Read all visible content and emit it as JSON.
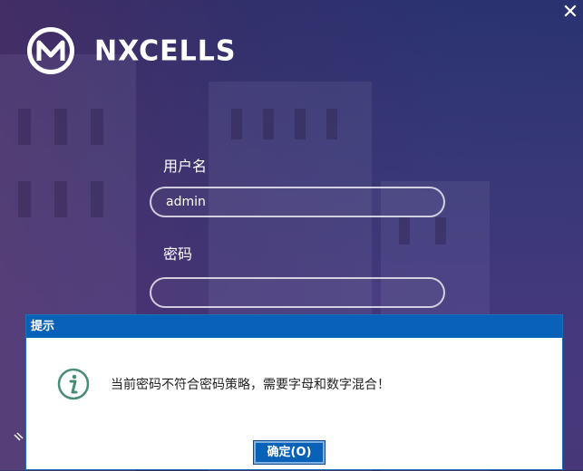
{
  "app": {
    "brand": "NXCELLS"
  },
  "window": {
    "close_glyph": "✕"
  },
  "login": {
    "username_label": "用户名",
    "username_value": "admin",
    "password_label": "密码",
    "password_value": ""
  },
  "dialog": {
    "title": "提示",
    "message": "当前密码不符合密码策略，需要字母和数字混合！",
    "ok_label": "确定(O)",
    "icon": "info-icon"
  },
  "colors": {
    "dialog_title_bg": "#0a62b8",
    "info_icon": "#4a8c7a"
  }
}
